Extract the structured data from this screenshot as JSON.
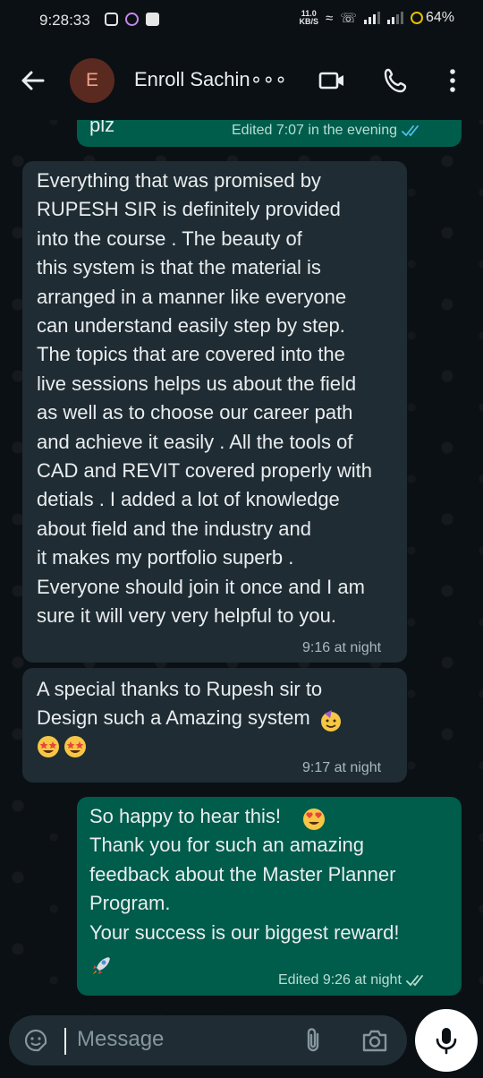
{
  "status_bar": {
    "time": "9:28:33",
    "net_speed_top": "11.0",
    "net_speed_unit": "KB/S",
    "battery": "64%"
  },
  "header": {
    "avatar_letter": "E",
    "contact_name": "Enroll Sachin∘∘∘",
    "icons": [
      "back-arrow-icon",
      "video-call-icon",
      "phone-icon",
      "more-options-icon"
    ]
  },
  "messages": [
    {
      "direction": "outgoing",
      "text": "plz",
      "meta": "Edited 7:07 in the evening",
      "status": "read"
    },
    {
      "direction": "incoming",
      "text": "Everything that was promised by\nRUPESH SIR is definitely provided\ninto the course . The beauty of\nthis system is that the material is\narranged in a manner like everyone\ncan understand easily step by step.\nThe topics that are covered into the\nlive sessions helps us about the field\nas well as to choose our career path\nand achieve it easily . All the  tools  of\nCAD and REVIT covered properly with\ndetials . I added a lot of knowledge\nabout field and the industry and\nit makes my portfolio superb .\nEveryone should join it once and I am\nsure it will very very helpful to you.",
      "meta": "9:16 at night"
    },
    {
      "direction": "incoming",
      "text": "A special thanks to Rupesh sir to\nDesign such a Amazing system",
      "emojis": [
        "partying-face",
        "star-struck",
        "star-struck"
      ],
      "meta": "9:17 at night"
    },
    {
      "direction": "outgoing",
      "text": "So happy to hear this!\nThank you for such an amazing\nfeedback about the Master Planner\nProgram.\nYour success is our biggest reward!",
      "emojis": [
        "heart-eyes",
        "rocket"
      ],
      "meta": "Edited 9:26 at night",
      "status": "delivered"
    }
  ],
  "input": {
    "placeholder": "Message"
  },
  "colors": {
    "background": "#0b1014",
    "incoming_bubble": "#1f2c33",
    "outgoing_bubble": "#005c4b",
    "read_tick": "#53bdeb",
    "text": "#e9edef"
  }
}
